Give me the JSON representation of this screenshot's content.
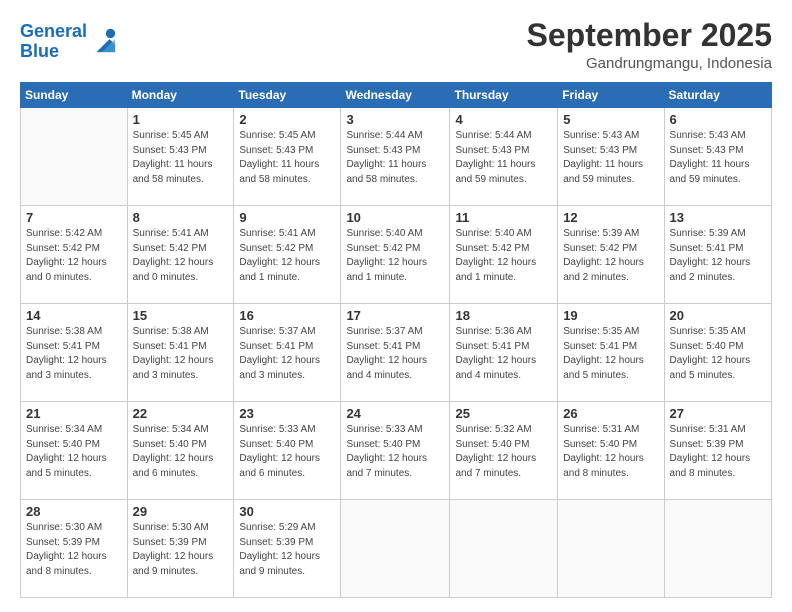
{
  "logo": {
    "line1": "General",
    "line2": "Blue"
  },
  "title": "September 2025",
  "subtitle": "Gandrungmangu, Indonesia",
  "weekdays": [
    "Sunday",
    "Monday",
    "Tuesday",
    "Wednesday",
    "Thursday",
    "Friday",
    "Saturday"
  ],
  "weeks": [
    [
      {
        "day": "",
        "info": ""
      },
      {
        "day": "1",
        "info": "Sunrise: 5:45 AM\nSunset: 5:43 PM\nDaylight: 11 hours\nand 58 minutes."
      },
      {
        "day": "2",
        "info": "Sunrise: 5:45 AM\nSunset: 5:43 PM\nDaylight: 11 hours\nand 58 minutes."
      },
      {
        "day": "3",
        "info": "Sunrise: 5:44 AM\nSunset: 5:43 PM\nDaylight: 11 hours\nand 58 minutes."
      },
      {
        "day": "4",
        "info": "Sunrise: 5:44 AM\nSunset: 5:43 PM\nDaylight: 11 hours\nand 59 minutes."
      },
      {
        "day": "5",
        "info": "Sunrise: 5:43 AM\nSunset: 5:43 PM\nDaylight: 11 hours\nand 59 minutes."
      },
      {
        "day": "6",
        "info": "Sunrise: 5:43 AM\nSunset: 5:43 PM\nDaylight: 11 hours\nand 59 minutes."
      }
    ],
    [
      {
        "day": "7",
        "info": "Sunrise: 5:42 AM\nSunset: 5:42 PM\nDaylight: 12 hours\nand 0 minutes."
      },
      {
        "day": "8",
        "info": "Sunrise: 5:41 AM\nSunset: 5:42 PM\nDaylight: 12 hours\nand 0 minutes."
      },
      {
        "day": "9",
        "info": "Sunrise: 5:41 AM\nSunset: 5:42 PM\nDaylight: 12 hours\nand 1 minute."
      },
      {
        "day": "10",
        "info": "Sunrise: 5:40 AM\nSunset: 5:42 PM\nDaylight: 12 hours\nand 1 minute."
      },
      {
        "day": "11",
        "info": "Sunrise: 5:40 AM\nSunset: 5:42 PM\nDaylight: 12 hours\nand 1 minute."
      },
      {
        "day": "12",
        "info": "Sunrise: 5:39 AM\nSunset: 5:42 PM\nDaylight: 12 hours\nand 2 minutes."
      },
      {
        "day": "13",
        "info": "Sunrise: 5:39 AM\nSunset: 5:41 PM\nDaylight: 12 hours\nand 2 minutes."
      }
    ],
    [
      {
        "day": "14",
        "info": "Sunrise: 5:38 AM\nSunset: 5:41 PM\nDaylight: 12 hours\nand 3 minutes."
      },
      {
        "day": "15",
        "info": "Sunrise: 5:38 AM\nSunset: 5:41 PM\nDaylight: 12 hours\nand 3 minutes."
      },
      {
        "day": "16",
        "info": "Sunrise: 5:37 AM\nSunset: 5:41 PM\nDaylight: 12 hours\nand 3 minutes."
      },
      {
        "day": "17",
        "info": "Sunrise: 5:37 AM\nSunset: 5:41 PM\nDaylight: 12 hours\nand 4 minutes."
      },
      {
        "day": "18",
        "info": "Sunrise: 5:36 AM\nSunset: 5:41 PM\nDaylight: 12 hours\nand 4 minutes."
      },
      {
        "day": "19",
        "info": "Sunrise: 5:35 AM\nSunset: 5:41 PM\nDaylight: 12 hours\nand 5 minutes."
      },
      {
        "day": "20",
        "info": "Sunrise: 5:35 AM\nSunset: 5:40 PM\nDaylight: 12 hours\nand 5 minutes."
      }
    ],
    [
      {
        "day": "21",
        "info": "Sunrise: 5:34 AM\nSunset: 5:40 PM\nDaylight: 12 hours\nand 5 minutes."
      },
      {
        "day": "22",
        "info": "Sunrise: 5:34 AM\nSunset: 5:40 PM\nDaylight: 12 hours\nand 6 minutes."
      },
      {
        "day": "23",
        "info": "Sunrise: 5:33 AM\nSunset: 5:40 PM\nDaylight: 12 hours\nand 6 minutes."
      },
      {
        "day": "24",
        "info": "Sunrise: 5:33 AM\nSunset: 5:40 PM\nDaylight: 12 hours\nand 7 minutes."
      },
      {
        "day": "25",
        "info": "Sunrise: 5:32 AM\nSunset: 5:40 PM\nDaylight: 12 hours\nand 7 minutes."
      },
      {
        "day": "26",
        "info": "Sunrise: 5:31 AM\nSunset: 5:40 PM\nDaylight: 12 hours\nand 8 minutes."
      },
      {
        "day": "27",
        "info": "Sunrise: 5:31 AM\nSunset: 5:39 PM\nDaylight: 12 hours\nand 8 minutes."
      }
    ],
    [
      {
        "day": "28",
        "info": "Sunrise: 5:30 AM\nSunset: 5:39 PM\nDaylight: 12 hours\nand 8 minutes."
      },
      {
        "day": "29",
        "info": "Sunrise: 5:30 AM\nSunset: 5:39 PM\nDaylight: 12 hours\nand 9 minutes."
      },
      {
        "day": "30",
        "info": "Sunrise: 5:29 AM\nSunset: 5:39 PM\nDaylight: 12 hours\nand 9 minutes."
      },
      {
        "day": "",
        "info": ""
      },
      {
        "day": "",
        "info": ""
      },
      {
        "day": "",
        "info": ""
      },
      {
        "day": "",
        "info": ""
      }
    ]
  ]
}
